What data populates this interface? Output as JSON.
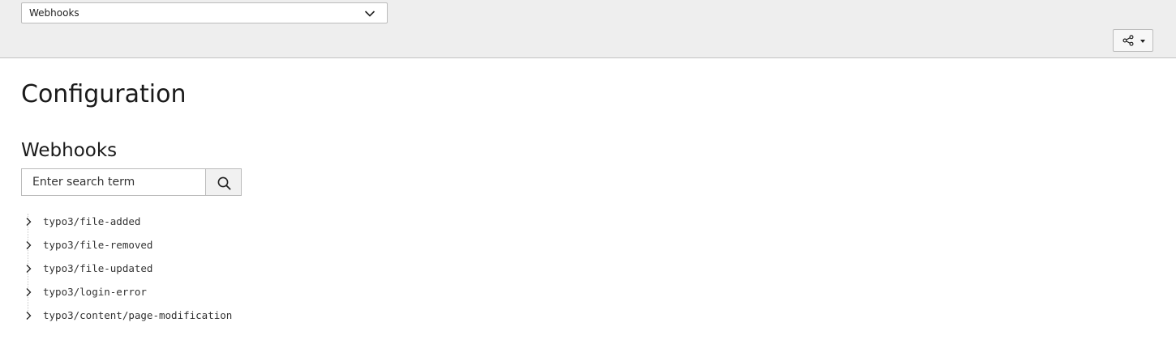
{
  "docheader": {
    "module_menu": {
      "selected": "Webhooks",
      "icon": "chevron-down-icon"
    },
    "share_button": {
      "icon": "share-icon",
      "dropdown_icon": "caret-down-icon"
    }
  },
  "page": {
    "title": "Configuration",
    "section_title": "Webhooks"
  },
  "search": {
    "placeholder": "Enter search term",
    "value": "",
    "button_icon": "magnifier-icon"
  },
  "tree": {
    "items": [
      {
        "label": "typo3/file-added",
        "expanded": false
      },
      {
        "label": "typo3/file-removed",
        "expanded": false
      },
      {
        "label": "typo3/file-updated",
        "expanded": false
      },
      {
        "label": "typo3/login-error",
        "expanded": false
      },
      {
        "label": "typo3/content/page-modification",
        "expanded": false
      }
    ]
  },
  "colors": {
    "header_background": "#eeeeee",
    "page_background": "#ffffff",
    "border": "#bbbbbb",
    "text": "#1a1a1a"
  }
}
